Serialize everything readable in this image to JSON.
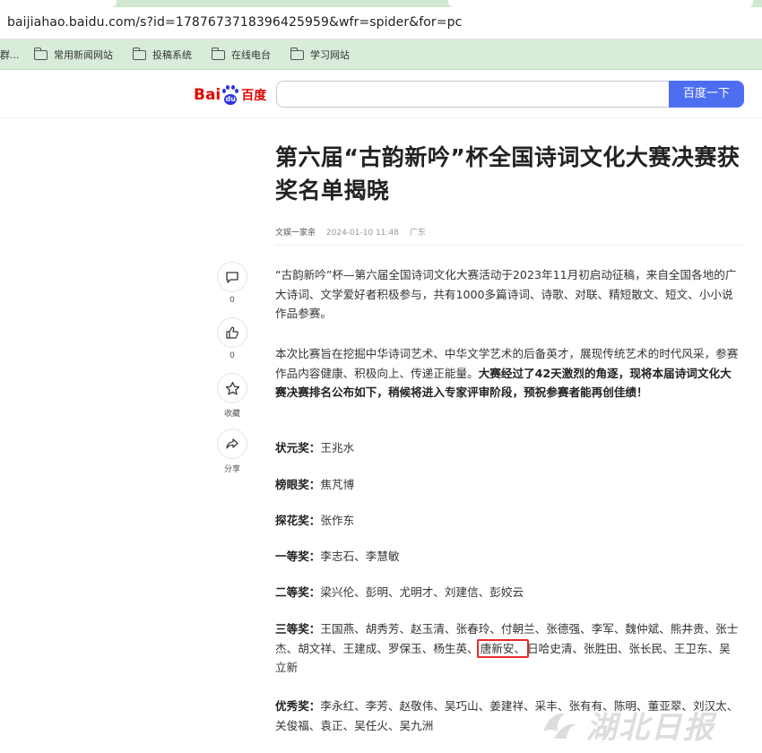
{
  "browser": {
    "url": "baijiahao.baidu.com/s?id=1787673718396425959&wfr=spider&for=pc",
    "bookmarks": [
      {
        "label": "群..."
      },
      {
        "label": "常用新闻网站"
      },
      {
        "label": "投稿系统"
      },
      {
        "label": "在线电台"
      },
      {
        "label": "学习网站"
      }
    ]
  },
  "header": {
    "logo_text_latin": "Bai",
    "logo_du": "du",
    "logo_text_cn": "百度",
    "search_placeholder": "",
    "search_button": "百度一下"
  },
  "article": {
    "title": "第六届“古韵新吟”杯全国诗词文化大赛决赛获奖名单揭晓",
    "author": "文娱一家亲",
    "date": "2024-01-10 11:48",
    "location": "广东",
    "intro1": "“古韵新吟”杯—第六届全国诗词文化大赛活动于2023年11月初启动征稿，来自全国各地的广大诗词、文学爱好者积极参与，共有1000多篇诗词、诗歌、对联、精短散文、短文、小小说作品参赛。",
    "intro2_plain": "本次比赛旨在挖掘中华诗词艺术、中华文学艺术的后备英才，展现传统艺术的时代风采，参赛作品内容健康、积极向上、传递正能量。",
    "intro2_bold": "大赛经过了42天激烈的角逐，现将本届诗词文化大赛决赛排名公布如下，稍候将进入专家评审阶段，预祝参赛者能再创佳绩！",
    "awards": {
      "zhuangyuan": {
        "label": "状元奖：",
        "names": "王兆水"
      },
      "bangyan": {
        "label": "榜眼奖：",
        "names": "焦芃博"
      },
      "tanhua": {
        "label": "探花奖：",
        "names": "张作东"
      },
      "first": {
        "label": "一等奖：",
        "names": "李志石、李慧敏"
      },
      "second": {
        "label": "二等奖：",
        "names": "梁兴伦、彭明、尤明才、刘建信、彭姣云"
      },
      "third": {
        "label": "三等奖：",
        "names_before": "王国燕、胡秀芳、赵玉清、张春玲、付朝兰、张德强、李军、魏仲斌、熊井贵、张士杰、胡文祥、王建成、罗保玉、杨生英、",
        "highlight": "唐新安、",
        "names_after": "日哈史清、张胜田、张长民、王卫东、吴立新"
      },
      "excellent": {
        "label": "优秀奖：",
        "names": "李永红、李芳、赵敬伟、吴巧山、姜建祥、采丰、张有有、陈明、董亚翠、刘汉太、关俊福、袁正、吴任火、吴九洲"
      }
    }
  },
  "sidebar": {
    "comment_count": "0",
    "like_count": "0",
    "favorite_label": "收藏",
    "share_label": "分享"
  },
  "watermark": {
    "text": "湖北日报"
  },
  "colors": {
    "baidu_red": "#e10601",
    "baidu_blue": "#2932e1",
    "search_button": "#4e6ef2",
    "highlight_border": "#e52a2a"
  }
}
